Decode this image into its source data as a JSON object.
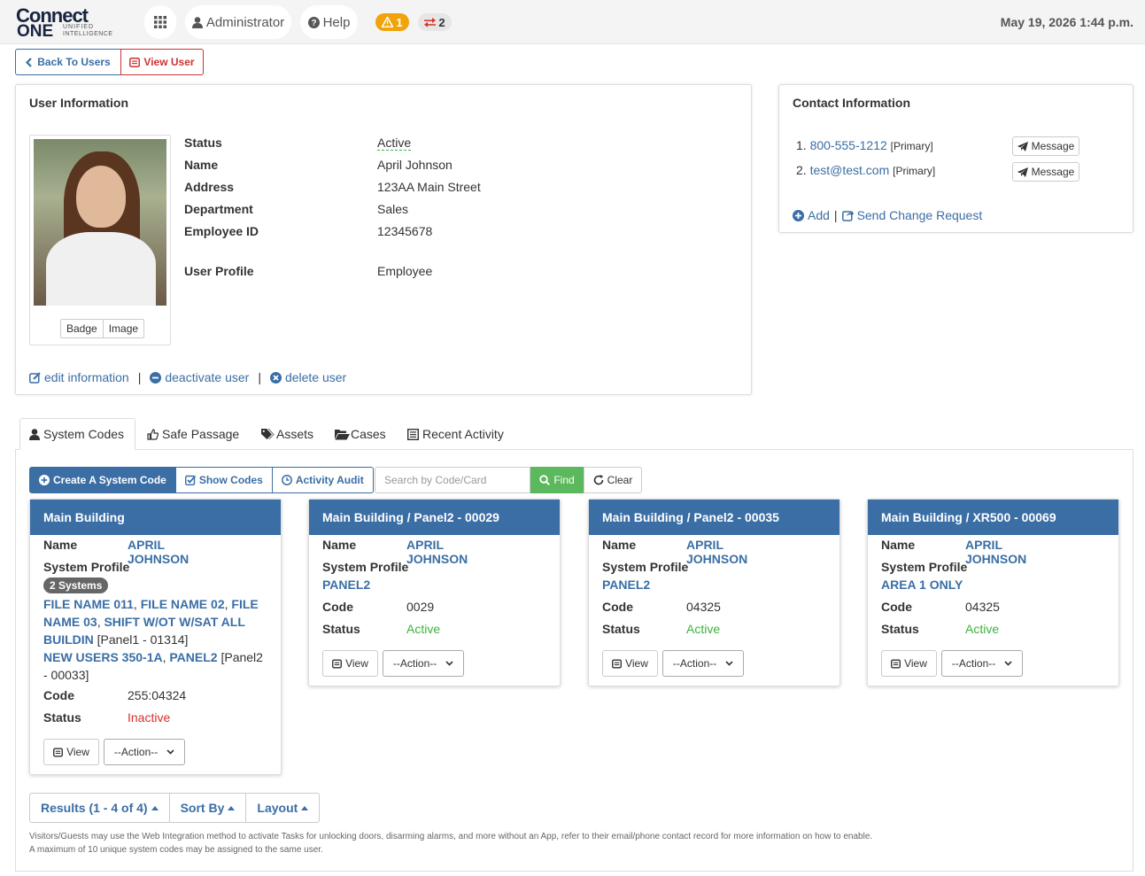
{
  "header": {
    "logo_line1": "Connect",
    "logo_line2": "ONE",
    "logo_sub1": "UNIFIED",
    "logo_sub2": "INTELLIGENCE",
    "admin_label": "Administrator",
    "help_label": "Help",
    "alerts_count": "1",
    "sync_count": "2",
    "datetime": "May 19, 2026 1:44 p.m."
  },
  "toolbar": {
    "back_label": "Back To Users",
    "view_user_label": "View User"
  },
  "user_info": {
    "title": "User Information",
    "badge_label": "Badge",
    "image_label": "Image",
    "fields": [
      {
        "label": "Status",
        "value": "Active"
      },
      {
        "label": "Name",
        "value": "April Johnson"
      },
      {
        "label": "Address",
        "value": "123AA Main Street"
      },
      {
        "label": "Department",
        "value": "Sales"
      },
      {
        "label": "Employee ID",
        "value": "12345678"
      },
      {
        "label": "User Profile",
        "value": "Employee"
      }
    ],
    "actions": {
      "edit": "edit information",
      "deactivate": "deactivate user",
      "delete": "delete user",
      "sep": "|"
    }
  },
  "contact_info": {
    "title": "Contact Information",
    "items": [
      {
        "num": "1.",
        "value": "800-555-1212",
        "tag": "[Primary]",
        "button": "Message"
      },
      {
        "num": "2.",
        "value": "test@test.com",
        "tag": "[Primary]",
        "button": "Message"
      }
    ],
    "add_label": "Add",
    "sep": "|",
    "change_label": "Send Change Request"
  },
  "tabs": [
    {
      "label": "System Codes",
      "icon": "user-icon"
    },
    {
      "label": "Safe Passage",
      "icon": "thumbs-up-icon"
    },
    {
      "label": "Assets",
      "icon": "tags-icon"
    },
    {
      "label": "Cases",
      "icon": "folder-open-icon"
    },
    {
      "label": "Recent Activity",
      "icon": "list-icon"
    }
  ],
  "codes_toolbar": {
    "create": "Create A System Code",
    "show": "Show Codes",
    "audit": "Activity Audit",
    "search_placeholder": "Search by Code/Card",
    "find": "Find",
    "clear": "Clear"
  },
  "card_labels": {
    "name": "Name",
    "system_profile": "System Profile",
    "code": "Code",
    "status": "Status",
    "view": "View",
    "action": "--Action--"
  },
  "cards": [
    {
      "title": "Main Building",
      "name": "APRIL JOHNSON",
      "systems_badge": "2 Systems",
      "files_a": "FILE NAME 011",
      "files_b": "FILE NAME 02",
      "files_c": "FILE",
      "files_d": "NAME 03",
      "files_e": "SHIFT W/OT W/SAT ALL",
      "files_f": "BUILDIN",
      "panel1_tag": "[Panel1 - 01314]",
      "users_a": "NEW USERS 350-1A",
      "users_b": "PANEL2",
      "panel2_tag_a": "[Panel2",
      "panel2_tag_b": "- 00033]",
      "code": "255:04324",
      "status": "Inactive"
    },
    {
      "title": "Main Building / Panel2 - 00029",
      "name": "APRIL JOHNSON",
      "profile": "PANEL2",
      "code": "0029",
      "status": "Active"
    },
    {
      "title": "Main Building / Panel2 - 00035",
      "name": "APRIL JOHNSON",
      "profile": "PANEL2",
      "code": "04325",
      "status": "Active"
    },
    {
      "title": "Main Building / XR500 - 00069",
      "name": "APRIL JOHNSON",
      "profile": "AREA 1 ONLY",
      "code": "04325",
      "status": "Active"
    }
  ],
  "results": {
    "results_label": "Results (1 - 4 of 4)",
    "sort_label": "Sort By",
    "layout_label": "Layout"
  },
  "notes": {
    "line1": "Visitors/Guests may use the Web Integration method to activate Tasks for unlocking doors, disarming alarms, and more without an App, refer to their email/phone contact record for more information on how to enable.",
    "line2": "A maximum of 10 unique system codes may be assigned to the same user."
  },
  "colors": {
    "brand_blue": "#3a6ea5",
    "active_green": "#3cb33c",
    "inactive_red": "#d9302c",
    "warning_orange": "#f0a30a",
    "danger_red": "#cc3333"
  }
}
